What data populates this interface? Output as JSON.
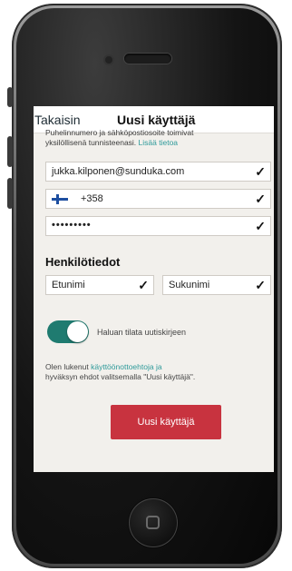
{
  "nav": {
    "back_label": "Takaisin",
    "title": "Uusi käyttäjä"
  },
  "intro": {
    "line1": "Puhelinnumero ja sähköpostiosoite toimivat",
    "line2": "yksilöllisenä tunnisteenasi.",
    "link": "Lisää tietoa"
  },
  "fields": {
    "email": "jukka.kilponen@sunduka.com",
    "phone_code": "+358",
    "password": "•••••••••"
  },
  "personal": {
    "heading": "Henkilötiedot",
    "first_name_placeholder": "Etunimi",
    "last_name_placeholder": "Sukunimi"
  },
  "newsletter": {
    "label": "Haluan tilata uutiskirjeen",
    "enabled": true
  },
  "terms": {
    "prefix": "Olen lukenut",
    "link": "käyttöönottoehtoja ja",
    "suffix_rest": "hyväksyn ehdot valitsemalla \"Uusi käyttäjä\"."
  },
  "submit_label": "Uusi käyttäjä",
  "icons": {
    "check": "checkmark-icon",
    "flag": "finland-flag-icon",
    "home": "home-button-icon"
  },
  "colors": {
    "accent_link": "#2e9a9a",
    "primary_button": "#c8333f",
    "toggle_on": "#1f7b70",
    "screen_bg": "#f2f0ec"
  }
}
